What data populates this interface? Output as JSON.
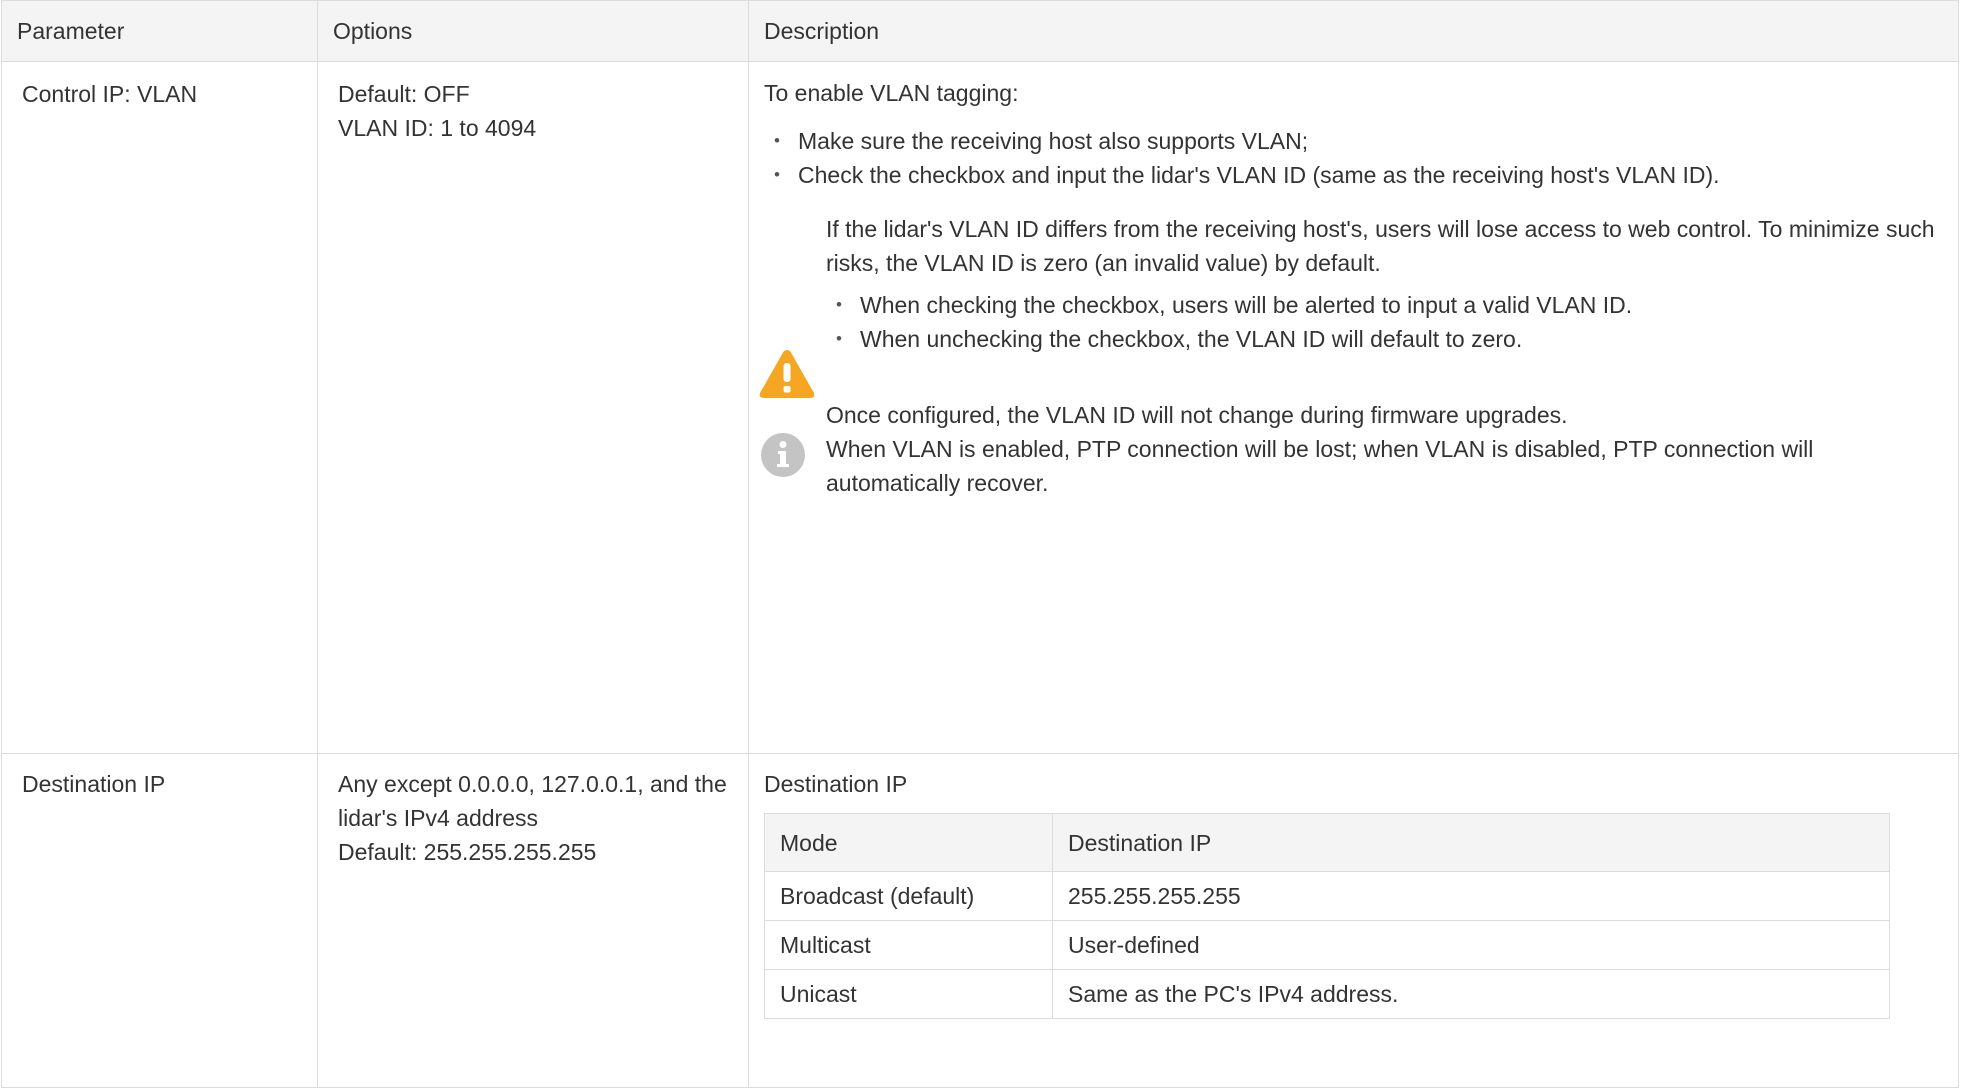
{
  "table": {
    "headers": [
      "Parameter",
      "Options",
      "Description"
    ],
    "rows": [
      {
        "parameter": "Control IP: VLAN",
        "options": [
          "Default: OFF",
          "VLAN ID: 1 to 4094"
        ],
        "description": {
          "intro": "To enable VLAN tagging:",
          "bullets": [
            "Make sure the receiving host also supports VLAN;",
            "Check the checkbox and input the lidar's VLAN ID (same as the receiving host's VLAN ID)."
          ],
          "warning": {
            "icon": "warning-triangle-icon",
            "text": "If the lidar's VLAN ID differs from the receiving host's, users will lose access to web control. To minimize such risks, the VLAN ID is zero (an invalid value) by default.",
            "bullets": [
              "When checking the checkbox, users will be alerted to input a valid VLAN ID.",
              "When unchecking the checkbox, the VLAN ID will default to zero."
            ]
          },
          "note": {
            "icon": "info-icon",
            "lines": [
              "Once configured, the VLAN ID will not change during firmware upgrades.",
              "When VLAN is enabled, PTP connection will be lost; when VLAN is disabled, PTP connection will automatically recover."
            ]
          }
        }
      },
      {
        "parameter": "Destination IP",
        "options": [
          "Any except 0.0.0.0, 127.0.0.1, and the lidar's IPv4 address",
          "Default: 255.255.255.255"
        ],
        "description": {
          "title": "Destination IP",
          "subtable": {
            "headers": [
              "Mode",
              "Destination IP"
            ],
            "rows": [
              [
                "Broadcast (default)",
                "255.255.255.255"
              ],
              [
                "Multicast",
                "User-defined"
              ],
              [
                "Unicast",
                "Same as the PC's IPv4 address."
              ]
            ]
          }
        }
      }
    ]
  },
  "colors": {
    "warning": "#f5a623",
    "info": "#c4c4c4",
    "header_bg": "#f4f4f4",
    "border": "#dcdcdc"
  }
}
